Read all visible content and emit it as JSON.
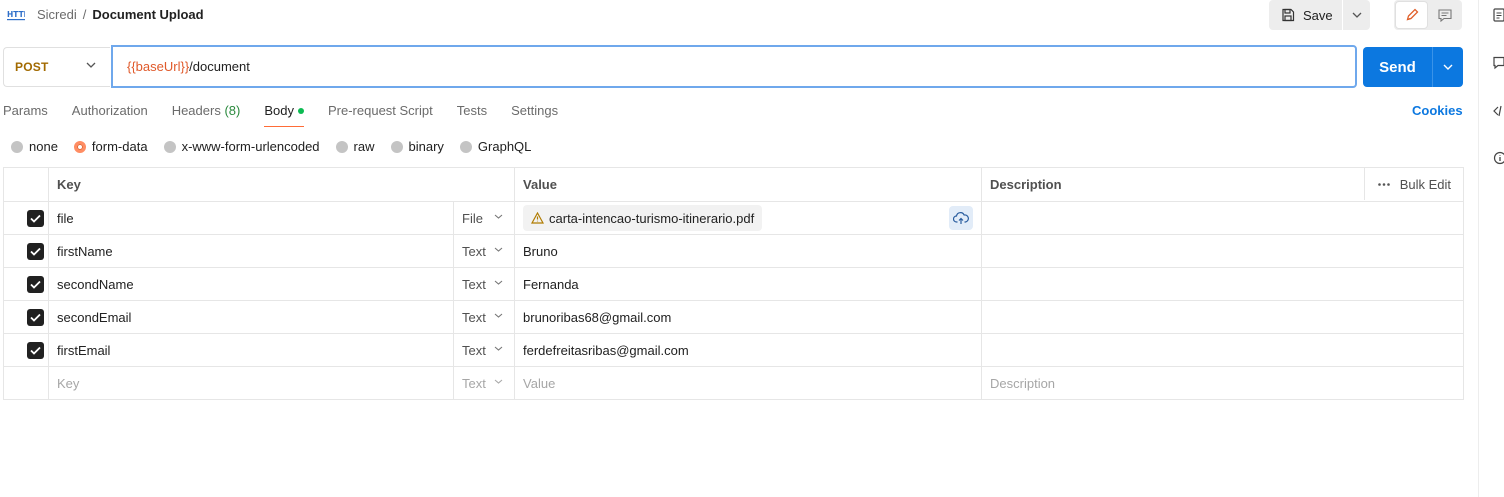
{
  "header": {
    "http_icon_label": "HTTP",
    "breadcrumb_parent": "Sicredi",
    "breadcrumb_separator": "/",
    "request_name": "Document Upload",
    "save_label": "Save"
  },
  "request": {
    "method": "POST",
    "url_variable": "{{baseUrl}}",
    "url_path": "/document",
    "send_label": "Send"
  },
  "tabs": [
    {
      "label": "Params"
    },
    {
      "label": "Authorization"
    },
    {
      "label": "Headers",
      "count": "(8)"
    },
    {
      "label": "Body",
      "active": true,
      "has_dot": true
    },
    {
      "label": "Pre-request Script"
    },
    {
      "label": "Tests"
    },
    {
      "label": "Settings"
    }
  ],
  "cookies_label": "Cookies",
  "body_types": [
    {
      "label": "none"
    },
    {
      "label": "form-data",
      "selected": true
    },
    {
      "label": "x-www-form-urlencoded"
    },
    {
      "label": "raw"
    },
    {
      "label": "binary"
    },
    {
      "label": "GraphQL"
    }
  ],
  "table": {
    "headers": {
      "key": "Key",
      "value": "Value",
      "description": "Description",
      "bulk_edit": "Bulk Edit"
    },
    "rows": [
      {
        "checked": true,
        "key": "file",
        "type": "File",
        "value": "carta-intencao-turismo-itinerario.pdf",
        "description": ""
      },
      {
        "checked": true,
        "key": "firstName",
        "type": "Text",
        "value": "Bruno",
        "description": ""
      },
      {
        "checked": true,
        "key": "secondName",
        "type": "Text",
        "value": "Fernanda",
        "description": ""
      },
      {
        "checked": true,
        "key": "secondEmail",
        "type": "Text",
        "value": "brunoribas68@gmail.com",
        "description": ""
      },
      {
        "checked": true,
        "key": "firstEmail",
        "type": "Text",
        "value": "ferdefreitasribas@gmail.com",
        "description": ""
      }
    ],
    "empty_row": {
      "key_placeholder": "Key",
      "type": "Text",
      "value_placeholder": "Value",
      "description_placeholder": "Description"
    }
  },
  "colors": {
    "accent": "#ff6c37",
    "send_blue": "#0c78e0",
    "method_post": "#a26a00",
    "url_variable": "#e05a2b",
    "active_dot": "#0cbb52"
  }
}
